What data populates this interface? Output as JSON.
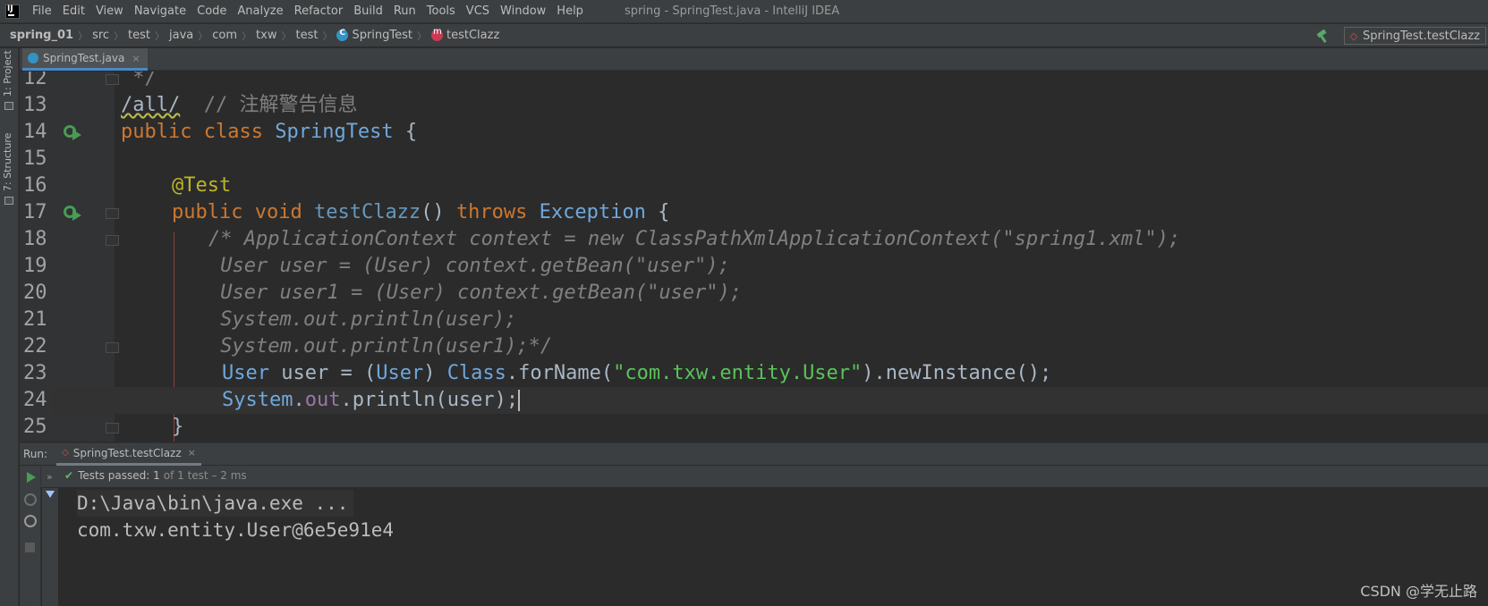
{
  "menubar": {
    "items": [
      {
        "label": "File"
      },
      {
        "label": "Edit"
      },
      {
        "label": "View"
      },
      {
        "label": "Navigate"
      },
      {
        "label": "Code"
      },
      {
        "label": "Analyze"
      },
      {
        "label": "Refactor"
      },
      {
        "label": "Build"
      },
      {
        "label": "Run"
      },
      {
        "label": "Tools"
      },
      {
        "label": "VCS"
      },
      {
        "label": "Window"
      },
      {
        "label": "Help"
      }
    ],
    "window_title": "spring - SpringTest.java - IntelliJ IDEA"
  },
  "breadcrumbs": {
    "project": "spring_01",
    "items": [
      "src",
      "test",
      "java",
      "com",
      "txw",
      "test"
    ],
    "class": "SpringTest",
    "method": "testClazz",
    "separator": "〉"
  },
  "run_config": {
    "label": "SpringTest.testClazz"
  },
  "left_strip": {
    "project_tab": "1: Project",
    "structure_tab": "7: Structure"
  },
  "editor_tab": {
    "filename": "SpringTest.java",
    "close": "×"
  },
  "code": {
    "line_numbers": [
      "12",
      "13",
      "14",
      "15",
      "16",
      "17",
      "18",
      "19",
      "20",
      "21",
      "22",
      "23",
      "24",
      "25"
    ],
    "l12": " */",
    "l13_typo": "/all/",
    "l13_comment": "  // 注解警告信息",
    "l14_kw1": "public",
    "l14_kw2": "class",
    "l14_cls": "SpringTest",
    "l14_brace": " {",
    "l16_ann": "@Test",
    "l17_kw1": "public",
    "l17_kw2": "void",
    "l17_fn": "testClazz",
    "l17_paren": "() ",
    "l17_kw3": "throws",
    "l17_cls": "Exception",
    "l17_brace": " {",
    "l18": "/* ApplicationContext context = new ClassPathXmlApplicationContext(\"spring1.xml\");",
    "l19": " User user = (User) context.getBean(\"user\");",
    "l20": " User user1 = (User) context.getBean(\"user\");",
    "l21": " System.out.println(user);",
    "l22": " System.out.println(user1);*/",
    "l23_t1": "User",
    "l23_t2": " user = (",
    "l23_t3": "User",
    "l23_t4": ") ",
    "l23_t5": "Class",
    "l23_t6": ".forName(",
    "l23_str": "\"com.txw.entity.User\"",
    "l23_t7": ").newInstance();",
    "l24_t1": "System",
    "l24_t2": ".",
    "l24_fld": "out",
    "l24_t3": ".println(user);",
    "l25": "}"
  },
  "run_panel": {
    "label": "Run:",
    "tab_label": "SpringTest.testClazz",
    "tab_close": "×",
    "expand": "»",
    "tests_passed_label": "Tests passed:",
    "tests_passed_count": "1",
    "tests_passed_detail": "of 1 test – 2 ms",
    "console_lines": [
      "D:\\Java\\bin\\java.exe ...",
      "com.txw.entity.User@6e5e91e4"
    ]
  },
  "watermark": "CSDN @学无止路",
  "icons": {
    "app": "intellij-logo-icon",
    "build": "hammer-icon",
    "run_gutter": "run-test-icon",
    "check": "check-icon",
    "play": "play-icon",
    "stop": "stop-icon"
  },
  "colors": {
    "background": "#2b2b2b",
    "keyword": "#cc7832",
    "string": "#5ac35a",
    "comment": "#808080",
    "class": "#6fa8dc"
  }
}
